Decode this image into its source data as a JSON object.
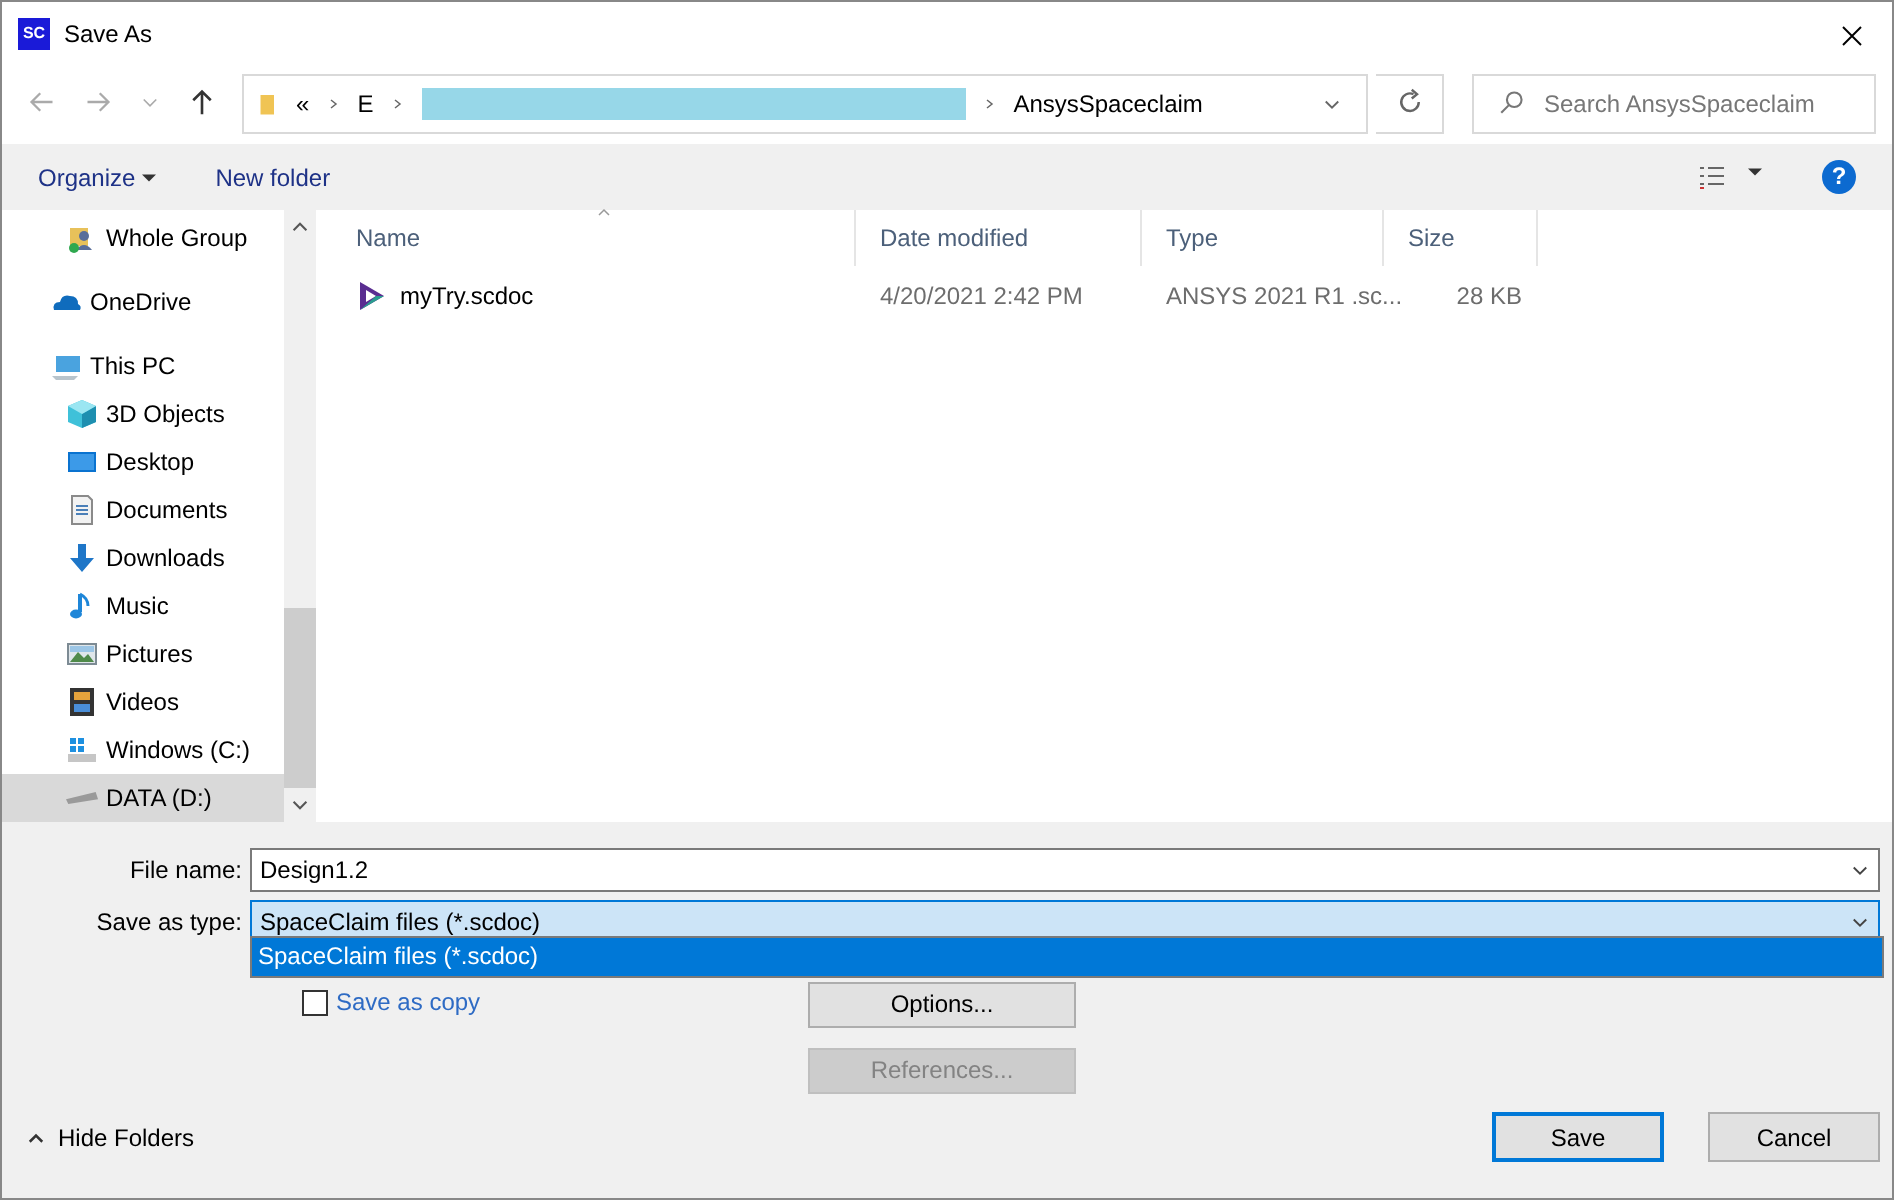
{
  "window": {
    "title": "Save As",
    "app_badge": "SC"
  },
  "address_bar": {
    "segments": [
      "«",
      "E"
    ],
    "current": "AnsysSpaceclaim"
  },
  "search": {
    "placeholder": "Search AnsysSpaceclaim"
  },
  "toolbar": {
    "organize": "Organize",
    "new_folder": "New folder",
    "help": "?"
  },
  "sidebar": {
    "items": [
      {
        "label": "Whole Group",
        "kind": "group",
        "selected": false
      },
      {
        "label": "OneDrive",
        "kind": "cloud",
        "selected": false
      },
      {
        "label": "This PC",
        "kind": "pc",
        "selected": false,
        "children": [
          {
            "label": "3D Objects",
            "kind": "cube",
            "selected": false
          },
          {
            "label": "Desktop",
            "kind": "desktop",
            "selected": false
          },
          {
            "label": "Documents",
            "kind": "document",
            "selected": false
          },
          {
            "label": "Downloads",
            "kind": "download",
            "selected": false
          },
          {
            "label": "Music",
            "kind": "music",
            "selected": false
          },
          {
            "label": "Pictures",
            "kind": "pictures",
            "selected": false
          },
          {
            "label": "Videos",
            "kind": "videos",
            "selected": false
          },
          {
            "label": "Windows (C:)",
            "kind": "winDrive",
            "selected": false
          },
          {
            "label": "DATA (D:)",
            "kind": "drive",
            "selected": true
          }
        ]
      }
    ]
  },
  "table": {
    "columns": [
      {
        "label": "Name",
        "sorted": true
      },
      {
        "label": "Date modified",
        "sorted": false
      },
      {
        "label": "Type",
        "sorted": false
      },
      {
        "label": "Size",
        "sorted": false
      }
    ],
    "rows": [
      {
        "name": "myTry.scdoc",
        "date_modified": "4/20/2021 2:42 PM",
        "type": "ANSYS 2021 R1 .sc...",
        "size": "28 KB"
      }
    ]
  },
  "form": {
    "file_name_label": "File name:",
    "file_name": "Design1.2",
    "type_label": "Save as type:",
    "type_value": "SpaceClaim files (*.scdoc)",
    "type_options": [
      {
        "label": "SpaceClaim files (*.scdoc)",
        "selected": true
      }
    ],
    "save_as_copy": {
      "label": "Save as copy",
      "checked": false
    },
    "options_button": {
      "label": "Options...",
      "disabled": false
    },
    "references_button": {
      "label": "References...",
      "disabled": true
    }
  },
  "footer": {
    "hide_folders": "Hide Folders",
    "save": "Save",
    "cancel": "Cancel"
  }
}
